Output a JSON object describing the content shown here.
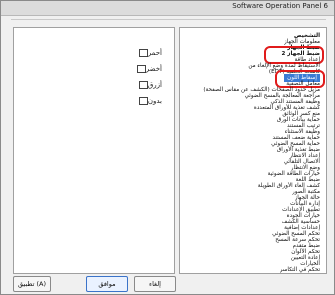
{
  "window": {
    "title": "Software Operation Panel 6"
  },
  "left_panel": {
    "colors": [
      {
        "label": "أحمر",
        "value": "red"
      },
      {
        "label": "أخضر",
        "value": "green"
      },
      {
        "label": "أزرق",
        "value": "blue"
      },
      {
        "label": "بدون",
        "value": "none"
      }
    ]
  },
  "tree": {
    "items": [
      {
        "label": "التشخيص",
        "bold": true
      },
      {
        "label": "معلومات الجهاز"
      },
      {
        "label": "ضبط الجهاز",
        "bold": true
      },
      {
        "label": "ضبط الجهاز 2",
        "bold": true,
        "highlight": true
      },
      {
        "label": "إعداد طاقة"
      },
      {
        "label": "الاستيقاظ لمدة وضع الإلغاء من"
      },
      {
        "label": "كاسحة الخلفية (EDT)"
      },
      {
        "label": "إسقاط اللون",
        "selected": true
      },
      {
        "label": "معامل التصفية"
      },
      {
        "label": "مزيل حدود الصفحات (الكشف عن مقاس الصفحة)"
      },
      {
        "label": "مراجعة المعالجة بالمسح الضوئي"
      },
      {
        "label": "وظيفة المستند الذكي"
      },
      {
        "label": "كشف تغذية للأوراق المتعددة"
      },
      {
        "label": "منع كسر الوثائق"
      },
      {
        "label": "حماية بيانات الورق"
      },
      {
        "label": "ترتيب المستند"
      },
      {
        "label": "وظيفة الاستثناء"
      },
      {
        "label": "حماية ضعف المستند"
      },
      {
        "label": "حماية المسح الضوئي"
      },
      {
        "label": "ضبط تغذية الأوراق"
      },
      {
        "label": "إعداد الانتظار"
      },
      {
        "label": "الاتصال التلقائي"
      },
      {
        "label": "وضع الانتظار"
      },
      {
        "label": "خيارات الطاقة الضوئية"
      },
      {
        "label": "ضبط اللغة"
      },
      {
        "label": "كشف إلغاء الأوراق الطويلة"
      },
      {
        "label": "مكتبة الصور"
      },
      {
        "label": "حالة الجهاز"
      },
      {
        "label": "إدارة البيانات"
      },
      {
        "label": "تطبيق الإعدادات"
      },
      {
        "label": "خيارات الجودة"
      },
      {
        "label": "حساسية الكشف"
      },
      {
        "label": "إعدادات إضافية"
      },
      {
        "label": "تحكم المسح الضوئي"
      },
      {
        "label": "تحكم سرعة المسح"
      },
      {
        "label": "ضبط متقدم"
      },
      {
        "label": "تحكم الألوان"
      },
      {
        "label": "إعادة التعيين"
      },
      {
        "label": "الخيارات"
      },
      {
        "label": "تحكم في التكاسر"
      }
    ]
  },
  "buttons": {
    "ok": "موافق",
    "cancel": "إلغاء",
    "apply": "تطبيق (A)"
  }
}
